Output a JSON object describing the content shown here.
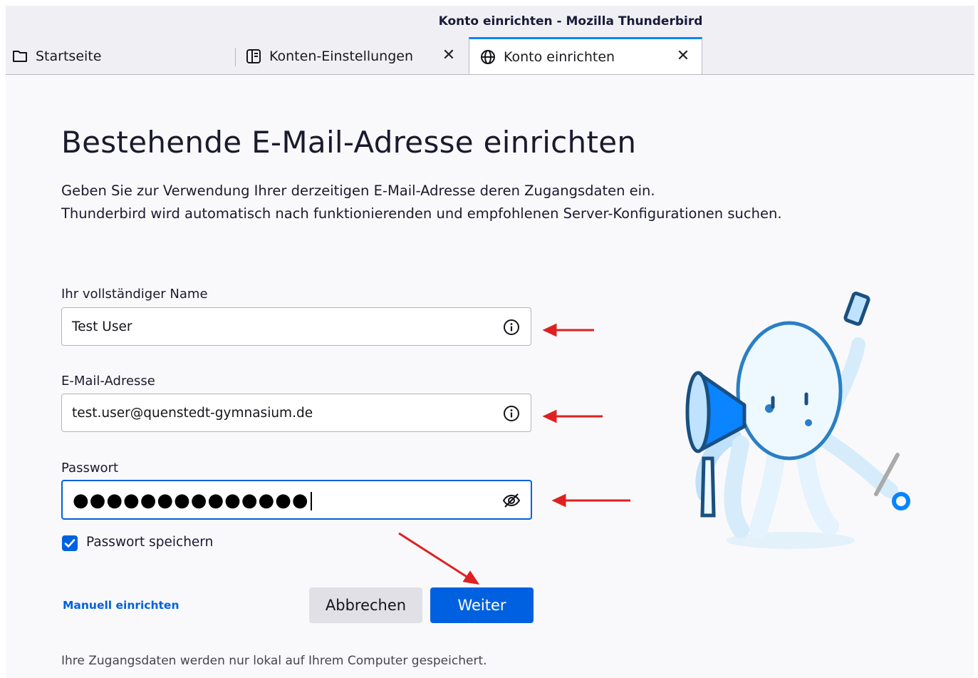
{
  "window": {
    "title": "Konto einrichten - Mozilla Thunderbird"
  },
  "tabs": [
    {
      "label": "Startseite",
      "icon": "folder-icon",
      "closable": false,
      "active": false
    },
    {
      "label": "Konten-Einstellungen",
      "icon": "account-settings-icon",
      "closable": true,
      "active": false
    },
    {
      "label": "Konto einrichten",
      "icon": "globe-icon",
      "closable": true,
      "active": true
    }
  ],
  "setup": {
    "heading": "Bestehende E-Mail-Adresse einrichten",
    "intro_line1": "Geben Sie zur Verwendung Ihrer derzeitigen E-Mail-Adresse deren Zugangsdaten ein.",
    "intro_line2": "Thunderbird wird automatisch nach funktionierenden und empfohlenen Server-Konfigurationen suchen.",
    "name_label": "Ihr vollständiger Name",
    "name_value": "Test User",
    "email_label": "E-Mail-Adresse",
    "email_value": "test.user@quenstedt-gymnasium.de",
    "password_label": "Passwort",
    "password_value": "●●●●●●●●●●●●●●",
    "remember_label": "Passwort speichern",
    "remember_checked": true,
    "manual_link": "Manuell einrichten",
    "cancel_label": "Abbrechen",
    "continue_label": "Weiter",
    "footnote": "Ihre Zugangsdaten werden nur lokal auf Ihrem Computer gespeichert."
  },
  "colors": {
    "accent": "#0061e0",
    "annotation": "#e02020"
  }
}
